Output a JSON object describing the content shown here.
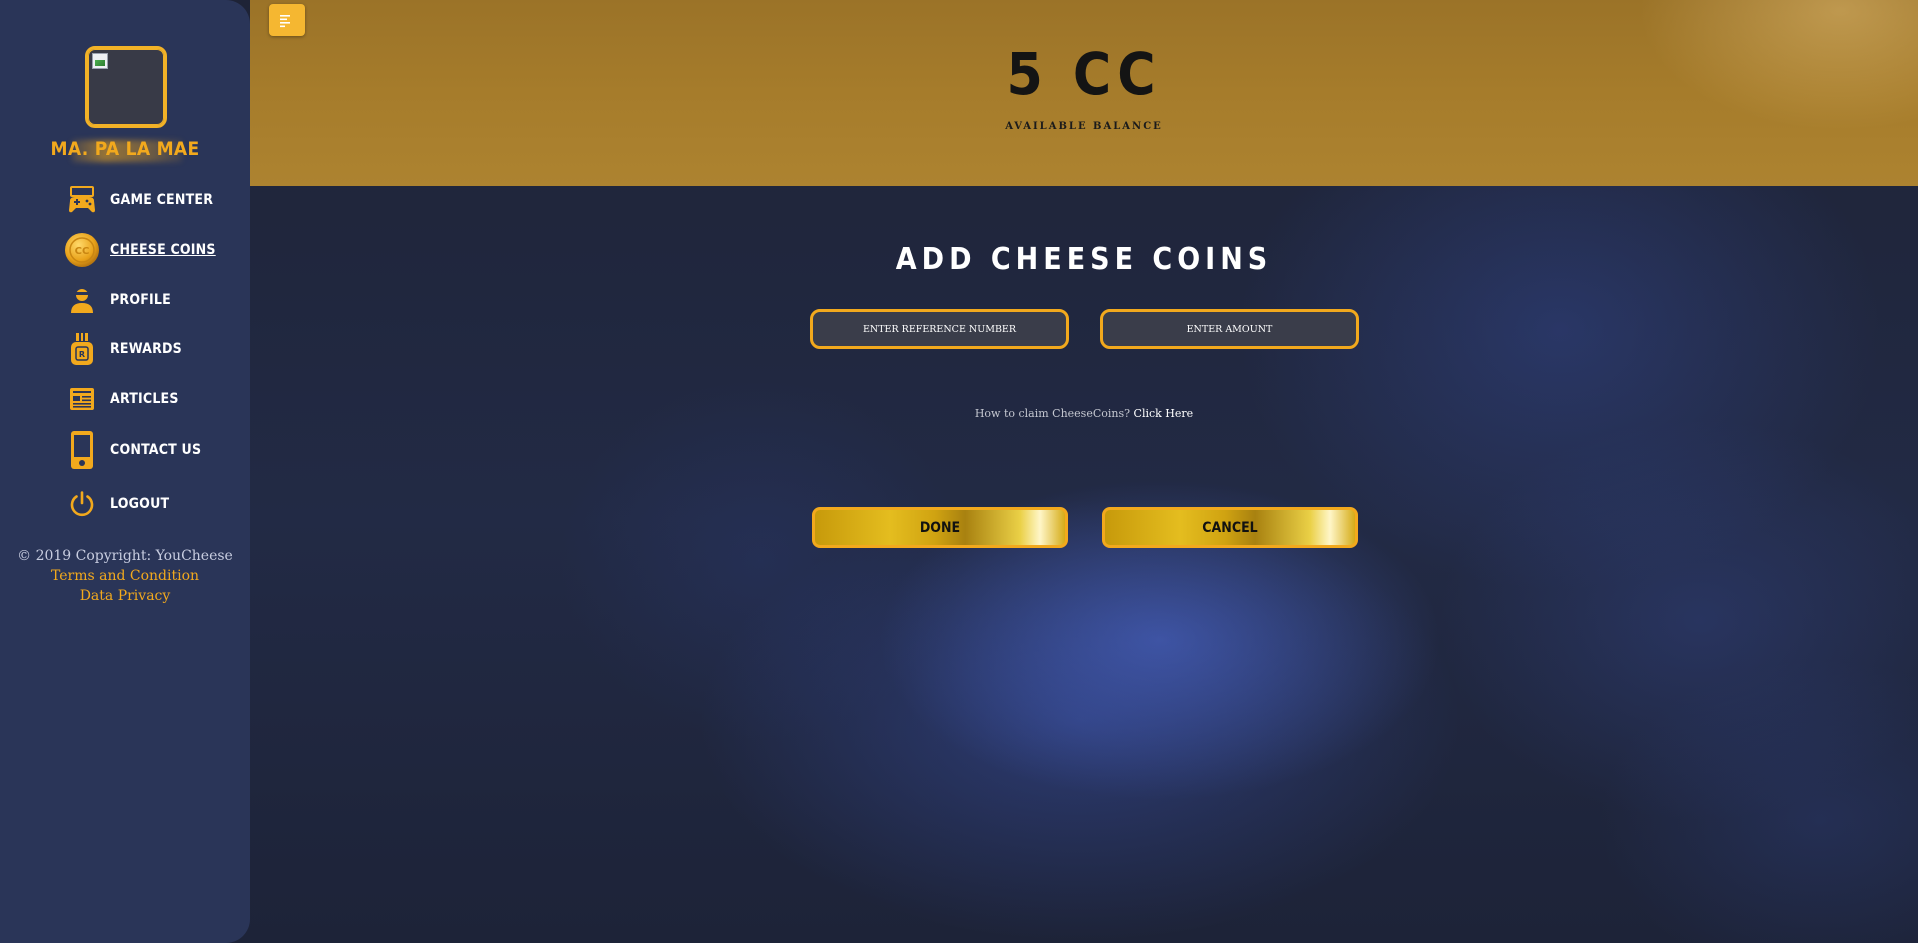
{
  "user": {
    "name": "MA. PA        LA MAE",
    "avatar_icon": "broken-image-icon"
  },
  "sidebar": {
    "items": [
      {
        "label": "GAME CENTER",
        "icon": "gamepad-icon"
      },
      {
        "label": "CHEESE COINS",
        "icon": "cheese-coin-icon",
        "active": true
      },
      {
        "label": "PROFILE",
        "icon": "user-icon"
      },
      {
        "label": "REWARDS",
        "icon": "medal-icon"
      },
      {
        "label": "ARTICLES",
        "icon": "newspaper-icon"
      },
      {
        "label": "CONTACT US",
        "icon": "phone-icon"
      },
      {
        "label": "LOGOUT",
        "icon": "power-icon"
      }
    ],
    "footer": {
      "copyright": "© 2019 Copyright: YouCheese",
      "terms": "Terms and Condition",
      "privacy": "Data Privacy"
    }
  },
  "header": {
    "menu_icon": "menu-icon",
    "balance": "5 CC",
    "balance_label": "AVAILABLE BALANCE"
  },
  "form": {
    "title": "ADD CHEESE COINS",
    "reference_placeholder": "ENTER REFERENCE NUMBER",
    "amount_placeholder": "ENTER AMOUNT",
    "claim_question": "How to claim CheeseCoins?",
    "claim_link": "Click Here",
    "done_label": "DONE",
    "cancel_label": "CANCEL"
  },
  "colors": {
    "accent": "#f2a91d",
    "sidebar": "#2a3558",
    "header": "#a67c2b",
    "background": "#1f2438"
  }
}
